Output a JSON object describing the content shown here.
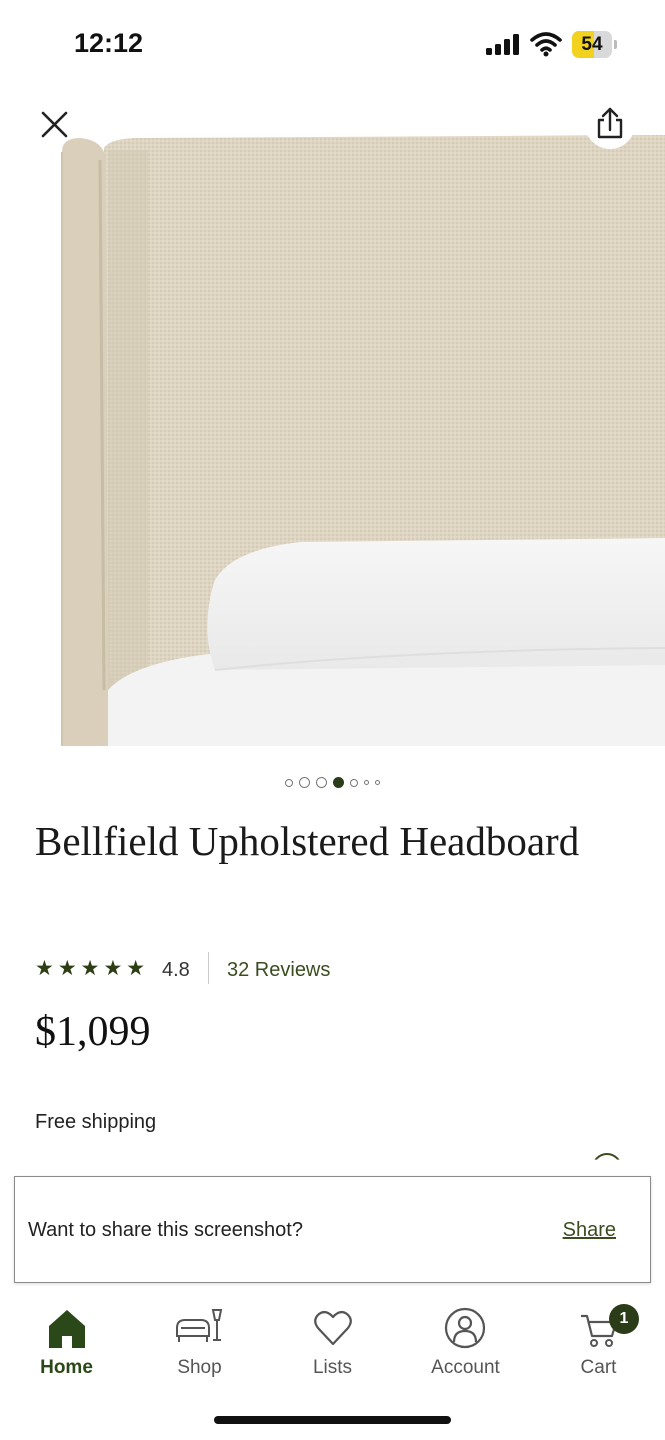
{
  "status_bar": {
    "time": "12:12",
    "battery": "54",
    "battery_level": 0.54
  },
  "product": {
    "title": "Bellfield Upholstered Headboard",
    "rating": "4.8",
    "stars": "★★★★★",
    "reviews_label": "32 Reviews",
    "price": "$1,099",
    "shipping": "Free shipping"
  },
  "gallery": {
    "image_count": 7,
    "active_index": 3
  },
  "toast": {
    "message": "Want to share this screenshot?",
    "action": "Share"
  },
  "tabbar": {
    "home": "Home",
    "shop": "Shop",
    "lists": "Lists",
    "account": "Account",
    "cart": "Cart",
    "cart_count": "1"
  },
  "colors": {
    "brand": "#2b4818",
    "fabric": "#ded5c2",
    "battery": "#f2d21e"
  }
}
